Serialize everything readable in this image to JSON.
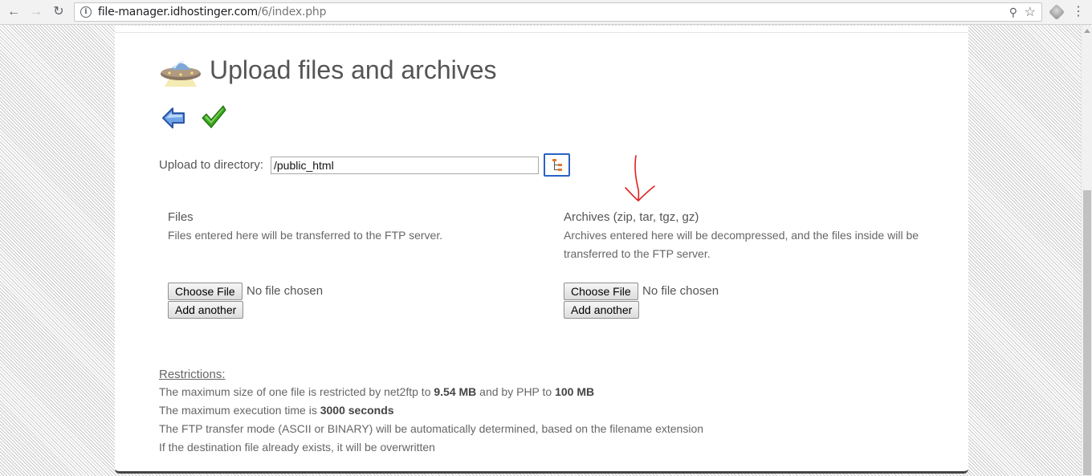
{
  "browser": {
    "url_host": "file-manager.idhostinger.com",
    "url_path": "/6/index.php"
  },
  "page": {
    "title": "Upload files and archives",
    "upload_label": "Upload to directory:",
    "directory_value": "/public_html"
  },
  "files_column": {
    "heading": "Files",
    "description": "Files entered here will be transferred to the FTP server.",
    "choose_label": "Choose File",
    "no_file_text": "No file chosen",
    "add_another_label": "Add another"
  },
  "archives_column": {
    "heading": "Archives (zip, tar, tgz, gz)",
    "description": "Archives entered here will be decompressed, and the files inside will be transferred to the FTP server.",
    "choose_label": "Choose File",
    "no_file_text": "No file chosen",
    "add_another_label": "Add another"
  },
  "restrictions": {
    "title": "Restrictions:",
    "line1_a": "The maximum size of one file is restricted by net2ftp to ",
    "line1_b": "9.54 MB",
    "line1_c": " and by PHP to ",
    "line1_d": "100 MB",
    "line2_a": "The maximum execution time is ",
    "line2_b": "3000 seconds",
    "line3": "The FTP transfer mode (ASCII or BINARY) will be automatically determined, based on the filename extension",
    "line4": "If the destination file already exists, it will be overwritten"
  },
  "icons": {
    "title": "ufo-icon",
    "back": "back-arrow-icon",
    "submit": "checkmark-icon",
    "browse": "directory-tree-icon"
  },
  "colors": {
    "accent_blue": "#2b62c3",
    "check_green": "#3aa51c",
    "annotation_red": "#e02020"
  }
}
